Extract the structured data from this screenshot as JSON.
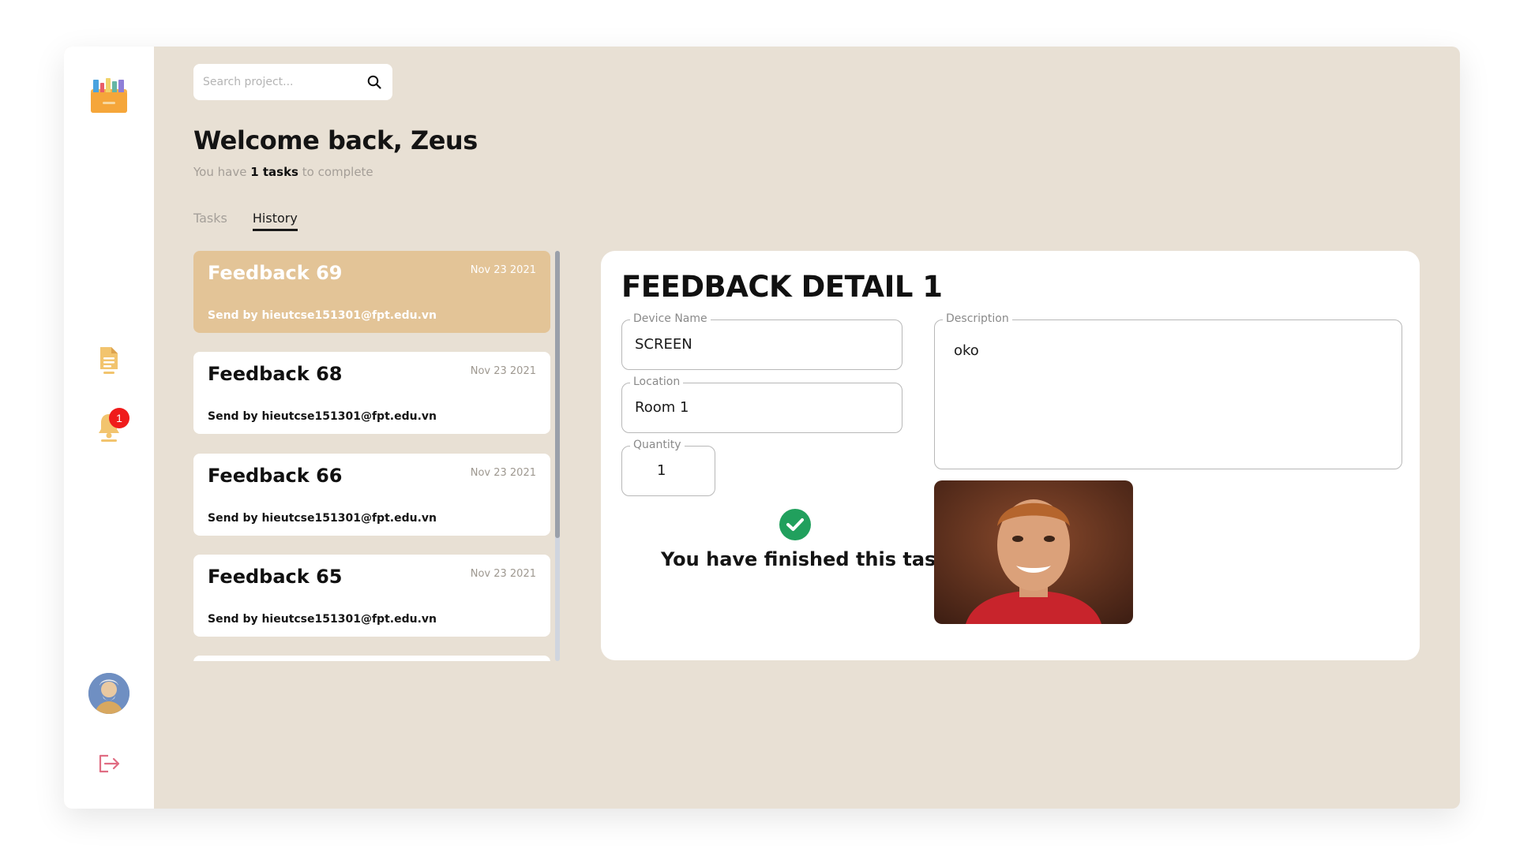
{
  "sidebar": {
    "logo_icon": "toolbox-logo-icon",
    "nav": [
      {
        "icon": "document-icon"
      },
      {
        "icon": "bell-icon",
        "badge": "1"
      }
    ],
    "avatar_icon": "user-avatar",
    "logout_icon": "logout-icon"
  },
  "search": {
    "placeholder": "Search project...",
    "icon": "search-icon"
  },
  "header": {
    "welcome": "Welcome back, Zeus",
    "subtitle_prefix": "You have ",
    "subtitle_count": "1 tasks",
    "subtitle_suffix": " to complete"
  },
  "tabs": [
    {
      "label": "Tasks",
      "active": false
    },
    {
      "label": "History",
      "active": true
    }
  ],
  "feedback_list": [
    {
      "title": "Feedback 69",
      "date": "Nov 23 2021",
      "sender": "Send by hieutcse151301@fpt.edu.vn",
      "selected": true
    },
    {
      "title": "Feedback 68",
      "date": "Nov 23 2021",
      "sender": "Send by hieutcse151301@fpt.edu.vn",
      "selected": false
    },
    {
      "title": "Feedback 66",
      "date": "Nov 23 2021",
      "sender": "Send by hieutcse151301@fpt.edu.vn",
      "selected": false
    },
    {
      "title": "Feedback 65",
      "date": "Nov 23 2021",
      "sender": "Send by hieutcse151301@fpt.edu.vn",
      "selected": false
    }
  ],
  "detail": {
    "title": "FEEDBACK DETAIL 1",
    "device_label": "Device Name",
    "device_value": "SCREEN",
    "location_label": "Location",
    "location_value": "Room 1",
    "quantity_label": "Quantity",
    "quantity_value": "1",
    "description_label": "Description",
    "description_value": "oko",
    "status_text": "You have finished this task",
    "status_icon": "check-circle-icon"
  },
  "colors": {
    "background": "#e8e0d4",
    "selected_card": "#e3c497",
    "accent_icon": "#f0b35a",
    "badge": "#ef1b1b",
    "success": "#21a05d",
    "logout": "#e06d83"
  }
}
